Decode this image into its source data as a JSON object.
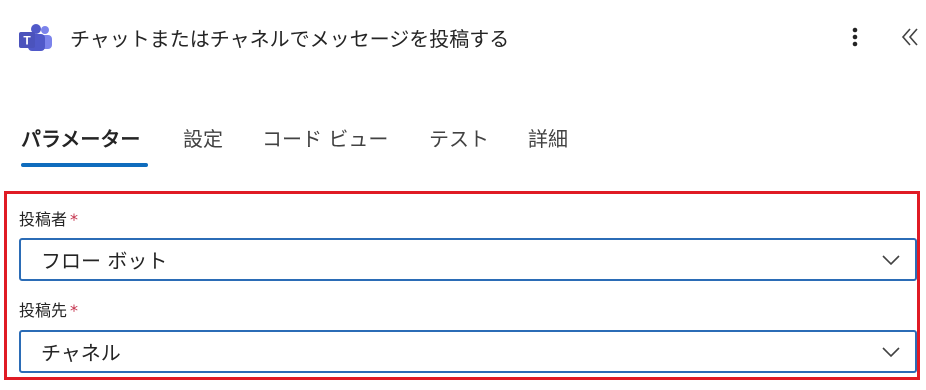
{
  "header": {
    "app_icon": "microsoft-teams-icon",
    "title": "チャットまたはチャネルでメッセージを投稿する",
    "more_icon": "more-vertical-icon",
    "collapse_icon": "double-chevron-left-icon"
  },
  "tabs": [
    {
      "label": "パラメーター",
      "active": true
    },
    {
      "label": "設定",
      "active": false
    },
    {
      "label": "コード ビュー",
      "active": false
    },
    {
      "label": "テスト",
      "active": false
    },
    {
      "label": "詳細",
      "active": false
    }
  ],
  "fields": [
    {
      "label": "投稿者",
      "required_mark": "*",
      "value": "フロー ボット"
    },
    {
      "label": "投稿先",
      "required_mark": "*",
      "value": "チャネル"
    }
  ],
  "colors": {
    "accent": "#0f6cbd",
    "highlight_border": "#e01b24",
    "dropdown_border": "#2b6cb6",
    "required": "#c4314b"
  }
}
